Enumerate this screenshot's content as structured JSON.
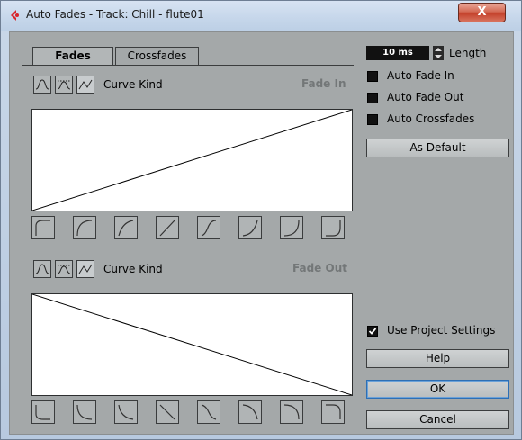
{
  "window": {
    "title": "Auto Fades - Track: Chill - flute01",
    "close_glyph": "X"
  },
  "tabs": [
    {
      "label": "Fades",
      "selected": true
    },
    {
      "label": "Crossfades",
      "selected": false
    }
  ],
  "fade_in": {
    "curve_kind_label": "Curve Kind",
    "section_label": "Fade In",
    "curve_kind_icons": [
      "spline-curve-icon",
      "damped-spline-curve-icon",
      "linear-curve-icon"
    ],
    "active_curve_kind": 2,
    "presets": [
      "fade-in-preset-1-icon",
      "fade-in-preset-2-icon",
      "fade-in-preset-3-icon",
      "fade-in-preset-4-icon",
      "fade-in-preset-5-icon",
      "fade-in-preset-6-icon",
      "fade-in-preset-7-icon",
      "fade-in-preset-8-icon"
    ]
  },
  "fade_out": {
    "curve_kind_label": "Curve Kind",
    "section_label": "Fade Out",
    "curve_kind_icons": [
      "spline-curve-icon",
      "damped-spline-curve-icon",
      "linear-curve-icon"
    ],
    "active_curve_kind": 2,
    "presets": [
      "fade-out-preset-1-icon",
      "fade-out-preset-2-icon",
      "fade-out-preset-3-icon",
      "fade-out-preset-4-icon",
      "fade-out-preset-5-icon",
      "fade-out-preset-6-icon",
      "fade-out-preset-7-icon",
      "fade-out-preset-8-icon"
    ]
  },
  "settings": {
    "length_value": "10 ms",
    "length_label": "Length",
    "auto_fade_in_label": "Auto Fade In",
    "auto_fade_in_checked": false,
    "auto_fade_out_label": "Auto Fade Out",
    "auto_fade_out_checked": false,
    "auto_crossfades_label": "Auto Crossfades",
    "auto_crossfades_checked": false,
    "as_default_label": "As Default",
    "use_project_settings_label": "Use Project Settings",
    "use_project_settings_checked": true,
    "help_label": "Help",
    "ok_label": "OK",
    "cancel_label": "Cancel"
  },
  "colors": {
    "panel_bg": "#a4a8a9",
    "title_bg": "#c5d6ea",
    "close_red": "#c4422c",
    "accent_focus": "#2d6fb5"
  }
}
